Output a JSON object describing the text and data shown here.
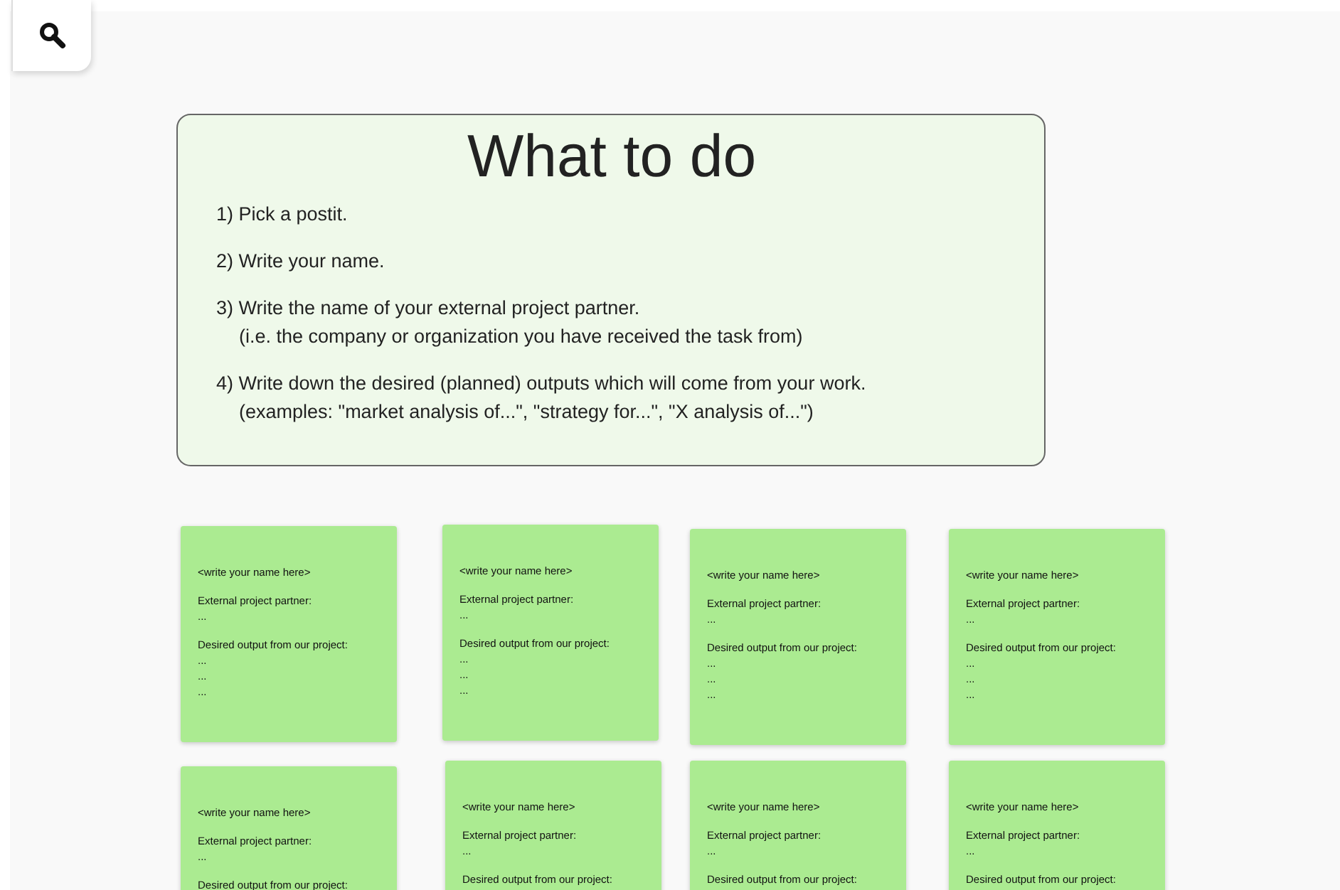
{
  "instructions": {
    "title": "What to do",
    "steps": [
      {
        "text": "1) Pick a postit."
      },
      {
        "text": "2) Write your name."
      },
      {
        "text": "3) Write the name of your external project partner.",
        "note": "(i.e. the company or organization you have received the task from)"
      },
      {
        "text": "4) Write down the desired (planned) outputs which will come from your work.",
        "note": "(examples: \"market analysis of...\", \"strategy for...\",  \"X analysis of...\")"
      }
    ]
  },
  "postits": [
    {
      "name": "<write your name here>",
      "partner_label": "External project partner:",
      "partner": "...",
      "output_label": "Desired output from our project:",
      "outputs": [
        "...",
        "...",
        "..."
      ]
    },
    {
      "name": "<write your name here>",
      "partner_label": "External project partner:",
      "partner": "...",
      "output_label": "Desired output from our project:",
      "outputs": [
        "...",
        "...",
        "..."
      ]
    },
    {
      "name": "<write your name here>",
      "partner_label": "External project partner:",
      "partner": "...",
      "output_label": "Desired output from our project:",
      "outputs": [
        "...",
        "...",
        "..."
      ]
    },
    {
      "name": "<write your name here>",
      "partner_label": "External project partner:",
      "partner": "...",
      "output_label": "Desired output from our project:",
      "outputs": [
        "...",
        "...",
        "..."
      ]
    },
    {
      "name": "<write your name here>",
      "partner_label": "External project partner:",
      "partner": "...",
      "output_label": "Desired output from our project:"
    },
    {
      "name": "<write your name here>",
      "partner_label": "External project partner:",
      "partner": "...",
      "output_label": "Desired output from our project:"
    },
    {
      "name": "<write your name here>",
      "partner_label": "External project partner:",
      "partner": "...",
      "output_label": "Desired output from our project:"
    },
    {
      "name": "<write your name here>",
      "partner_label": "External project partner:",
      "partner": "...",
      "output_label": "Desired output from our project:"
    }
  ]
}
